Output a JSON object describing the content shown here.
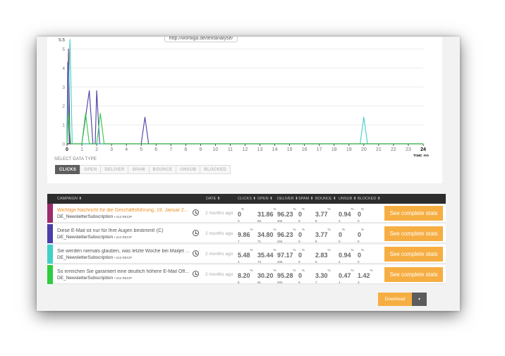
{
  "tooltip_text": "http://wortliga.de/textanalyse/",
  "select_data_type_label": "SELECT DATA TYPE",
  "data_types": [
    {
      "label": "CLICKS",
      "active": true
    },
    {
      "label": "OPEN",
      "active": false
    },
    {
      "label": "DELIVER",
      "active": false
    },
    {
      "label": "SPAM",
      "active": false
    },
    {
      "label": "BOUNCE",
      "active": false
    },
    {
      "label": "UNSUB",
      "active": false
    },
    {
      "label": "BLOCKED",
      "active": false
    }
  ],
  "chart_data": {
    "type": "line",
    "xlabel": "TIME (H)",
    "ylabel": "",
    "xlim": [
      0,
      24
    ],
    "ylim": [
      0,
      5.5
    ],
    "x_ticks": [
      "0",
      "1",
      "2",
      "3",
      "4",
      "5",
      "6",
      "7",
      "8",
      "9",
      "10",
      "11",
      "12",
      "13",
      "14",
      "15",
      "16",
      "17",
      "18",
      "19",
      "20",
      "21",
      "22",
      "23",
      "24"
    ],
    "y_ticks": [
      "0",
      "1",
      "2",
      "3",
      "4",
      "5",
      "5.5"
    ],
    "grid": true,
    "legend": "none",
    "series": [
      {
        "color": "#9c2c6c",
        "points": [
          [
            0,
            0
          ],
          [
            0.1,
            5
          ],
          [
            0.2,
            0
          ],
          [
            24,
            0
          ]
        ]
      },
      {
        "color": "#4a3fa8",
        "points": [
          [
            0,
            0
          ],
          [
            0.05,
            4.3
          ],
          [
            0.15,
            0
          ],
          [
            1,
            0
          ],
          [
            1.5,
            2.8
          ],
          [
            1.75,
            0
          ],
          [
            1.9,
            0
          ],
          [
            2,
            2.8
          ],
          [
            2.2,
            0
          ],
          [
            5,
            0
          ],
          [
            5.25,
            1.4
          ],
          [
            5.5,
            0
          ],
          [
            24,
            0
          ]
        ]
      },
      {
        "color": "#3fd0c8",
        "points": [
          [
            0,
            0
          ],
          [
            0.2,
            5.5
          ],
          [
            0.35,
            0
          ],
          [
            19.75,
            0
          ],
          [
            20,
            1.4
          ],
          [
            20.25,
            0
          ],
          [
            24,
            0
          ]
        ]
      },
      {
        "color": "#2ecc40",
        "points": [
          [
            0,
            0
          ],
          [
            0.1,
            1.6
          ],
          [
            0.25,
            0
          ],
          [
            1,
            0
          ],
          [
            1.25,
            1.6
          ],
          [
            1.5,
            0
          ],
          [
            2,
            0
          ],
          [
            2.25,
            1.6
          ],
          [
            2.5,
            0
          ],
          [
            24,
            0
          ]
        ]
      }
    ]
  },
  "table": {
    "headers": [
      "CAMPAIGN",
      "DATE",
      "CLICKS",
      "OPEN",
      "DELIVER",
      "SPAM",
      "BOUNCE",
      "UNSUB",
      "BLOCKED"
    ],
    "rows": [
      {
        "color": "#9c2c6c",
        "title": "Wichtige Nachricht für die Geschäftsführung, 19. Januar 2...",
        "title_highlight": true,
        "list": "DE_NewsletterSubscription",
        "recip": "• 212 RECIP",
        "date": "2 months ago",
        "stats": [
          {
            "pct": "0",
            "count": "0"
          },
          {
            "pct": "31.86",
            "count": "65"
          },
          {
            "pct": "96.23",
            "count": "204"
          },
          {
            "pct": "0",
            "count": "0"
          },
          {
            "pct": "3.77",
            "count": "8"
          },
          {
            "pct": "0.94",
            "count": "2"
          },
          {
            "pct": "0",
            "count": "0"
          }
        ],
        "button": "See complete stats"
      },
      {
        "color": "#4a3fa8",
        "title": "Diese E-Mail ist nur für Ihre Augen bestimmt! (C)",
        "title_highlight": false,
        "list": "DE_NewsletterSubscription",
        "recip": "• 212 RECIP",
        "date": "2 months ago",
        "stats": [
          {
            "pct": "9.86",
            "count": "7"
          },
          {
            "pct": "34.80",
            "count": "71"
          },
          {
            "pct": "96.23",
            "count": "204"
          },
          {
            "pct": "0",
            "count": "0"
          },
          {
            "pct": "3.77",
            "count": "8"
          },
          {
            "pct": "0",
            "count": "0"
          },
          {
            "pct": "0",
            "count": "0"
          }
        ],
        "button": "See complete stats"
      },
      {
        "color": "#3fd0c8",
        "title": "Sie werden niemals glauben, was letzte Woche bei Mailjet ...",
        "title_highlight": false,
        "list": "DE_NewsletterSubscription",
        "recip": "• 212 RECIP",
        "date": "2 months ago",
        "stats": [
          {
            "pct": "5.48",
            "count": "4"
          },
          {
            "pct": "35.44",
            "count": "73"
          },
          {
            "pct": "97.17",
            "count": "206"
          },
          {
            "pct": "0",
            "count": "0"
          },
          {
            "pct": "2.83",
            "count": "6"
          },
          {
            "pct": "0.94",
            "count": "2"
          },
          {
            "pct": "0",
            "count": "0"
          }
        ],
        "button": "See complete stats"
      },
      {
        "color": "#2ecc40",
        "title": "So erreichen Sie garantiert eine deutlich höhere E-Mail Öff...",
        "title_highlight": false,
        "list": "DE_NewsletterSubscription",
        "recip": "• 212 RECIP",
        "date": "2 months ago",
        "stats": [
          {
            "pct": "8.20",
            "count": "5"
          },
          {
            "pct": "30.20",
            "count": "61"
          },
          {
            "pct": "95.28",
            "count": "202"
          },
          {
            "pct": "0",
            "count": "0"
          },
          {
            "pct": "3.30",
            "count": "7"
          },
          {
            "pct": "0.47",
            "count": "1"
          },
          {
            "pct": "1.42",
            "count": "3"
          }
        ],
        "button": "See complete stats"
      }
    ]
  },
  "download_label": "Download",
  "download_caret": "▾"
}
